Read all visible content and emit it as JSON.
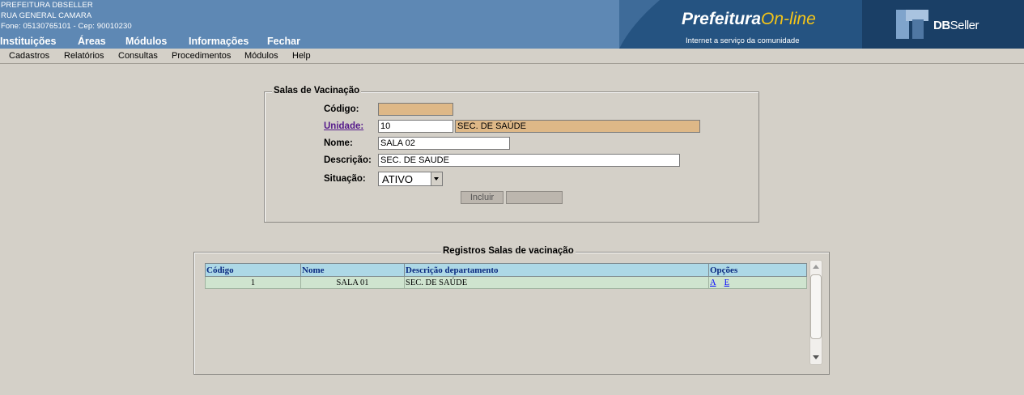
{
  "header": {
    "institution": "PREFEITURA DBSELLER",
    "address": "RUA GENERAL CAMARA",
    "contact": "Fone: 05130765101  -  Cep: 90010230",
    "top_nav": [
      "Instituições",
      "Áreas",
      "Módulos",
      "Informações",
      "Fechar"
    ],
    "brand_word1": "Prefeitura",
    "brand_word2": "On-line",
    "brand_tagline": "Internet a serviço da comunidade",
    "dbseller_bold": "DB",
    "dbseller_rest": "Seller"
  },
  "menu": [
    "Cadastros",
    "Relatórios",
    "Consultas",
    "Procedimentos",
    "Módulos",
    "Help"
  ],
  "form": {
    "legend": "Salas de Vacinação",
    "codigo_label": "Código:",
    "codigo_value": "",
    "unidade_label": "Unidade:",
    "unidade_code": "10",
    "unidade_name": "SEC. DE SAÚDE",
    "nome_label": "Nome:",
    "nome_value": "SALA 02",
    "descricao_label": "Descrição:",
    "descricao_value": "SEC. DE SAUDE",
    "situacao_label": "Situação:",
    "situacao_value": "ATIVO",
    "incluir_label": "Incluir",
    "second_button_label": ""
  },
  "grid": {
    "legend": "Registros Salas de vacinação",
    "columns": [
      "Código",
      "Nome",
      "Descrição departamento",
      "Opções"
    ],
    "rows": [
      {
        "codigo": "1",
        "nome": "SALA 01",
        "descricao": "SEC. DE SAÚDE",
        "opt_a": "A",
        "opt_e": "E"
      }
    ]
  },
  "colors": {
    "header_blue": "#5e88b4",
    "brand_dark": "#1f4b78",
    "readonly_field": "#deb887",
    "grid_header": "#add8e6",
    "grid_row": "#cfe4cf"
  }
}
